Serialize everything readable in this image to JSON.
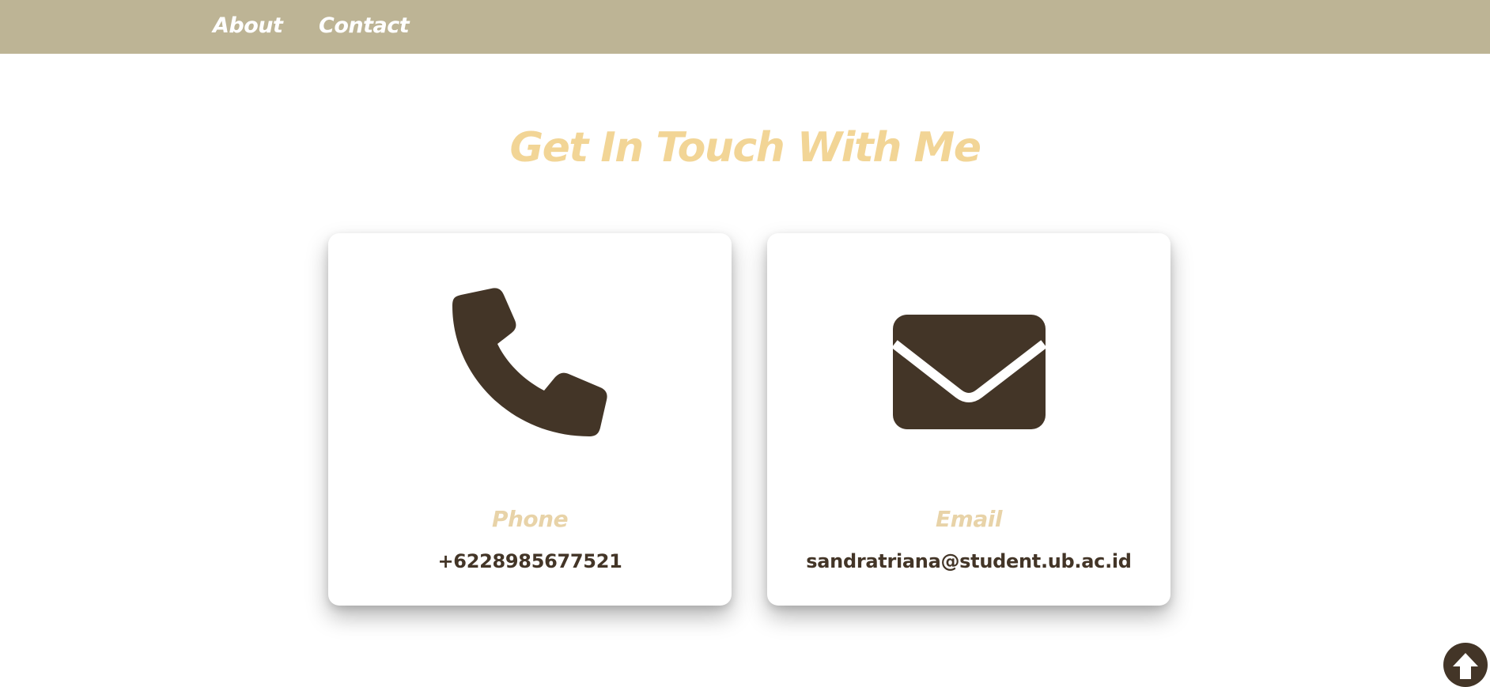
{
  "nav": {
    "items": [
      {
        "label": "About"
      },
      {
        "label": "Contact"
      }
    ]
  },
  "contact": {
    "title": "Get In Touch With Me",
    "cards": [
      {
        "icon": "phone-icon",
        "label": "Phone",
        "value": "+6228985677521"
      },
      {
        "icon": "envelope-icon",
        "label": "Email",
        "value": "sandratriana@student.ub.ac.id"
      }
    ]
  },
  "scroll_top": {
    "icon": "arrow-up-icon"
  },
  "colors": {
    "navbar": "#bdb495",
    "title": "#f2d596",
    "card_label": "#e8d3a8",
    "dark": "#433527"
  }
}
